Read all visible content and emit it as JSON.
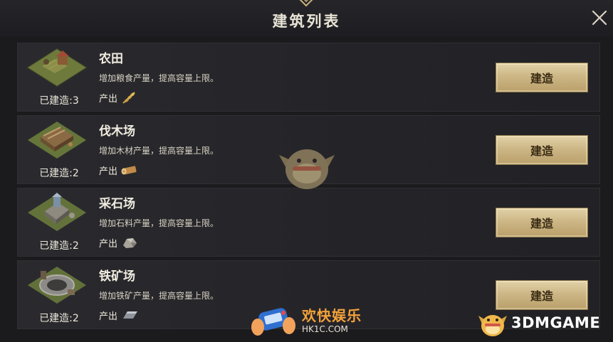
{
  "window": {
    "title": "建筑列表",
    "close_icon": "close-icon"
  },
  "buildings": [
    {
      "name": "农田",
      "description": "增加粮食产量，提高容量上限。",
      "built_label": "已建造:3",
      "output_label": "产出",
      "output_icon": "wheat-icon",
      "button_label": "建造"
    },
    {
      "name": "伐木场",
      "description": "增加木材产量，提高容量上限。",
      "built_label": "已建造:2",
      "output_label": "产出",
      "output_icon": "wood-log-icon",
      "button_label": "建造"
    },
    {
      "name": "采石场",
      "description": "增加石料产量，提高容量上限。",
      "built_label": "已建造:2",
      "output_label": "产出",
      "output_icon": "stone-icon",
      "button_label": "建造"
    },
    {
      "name": "铁矿场",
      "description": "增加铁矿产量，提高容量上限。",
      "built_label": "已建造:2",
      "output_label": "产出",
      "output_icon": "iron-ingot-icon",
      "button_label": "建造"
    }
  ],
  "watermarks": {
    "hk_title": "欢快娱乐",
    "hk_sub": "HK1C.COM",
    "brand": "3DMGAME"
  },
  "colors": {
    "background": "#1b1b1e",
    "row_background": "#26262a",
    "button_gold": "#cdb786",
    "button_text": "#3a2c14",
    "watermark_orange": "#f5a23a"
  }
}
